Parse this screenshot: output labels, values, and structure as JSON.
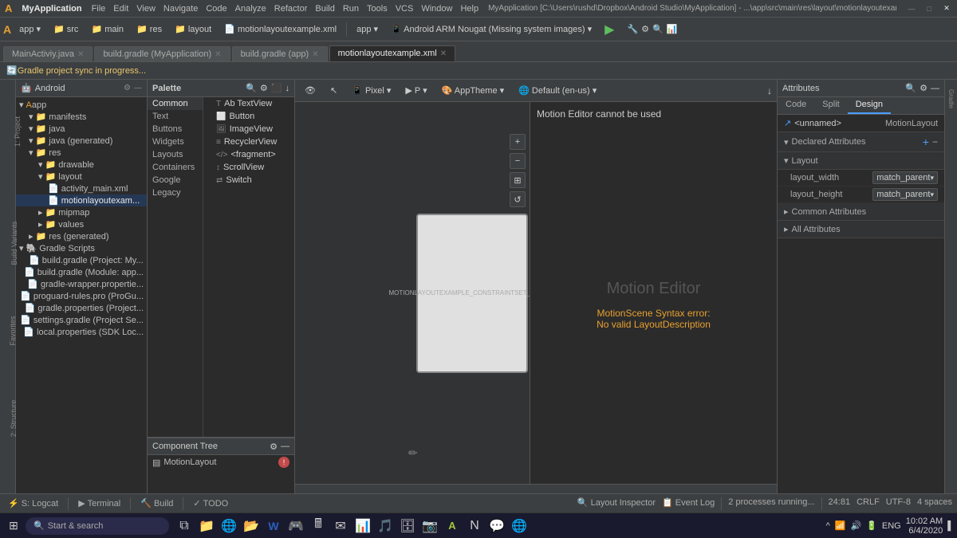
{
  "titlebar": {
    "app_name": "MyApplication",
    "menu": [
      "File",
      "Edit",
      "View",
      "Navigate",
      "Code",
      "Analyze",
      "Refactor",
      "Build",
      "Run",
      "Tools",
      "VCS",
      "Window",
      "Help"
    ],
    "path": "MyApplication [C:\\Users\\rushd\\Dropbox\\Android Studio\\MyApplication] - ...\\app\\src\\main\\res\\layout\\motionlayoutexample.xml [app]",
    "win_controls": [
      "—",
      "□",
      "✕"
    ]
  },
  "toolbar": {
    "project_name": "MyApplication",
    "breadcrumb": [
      "app",
      "src",
      "main",
      "res",
      "layout",
      "motionlayoutexample.xml"
    ]
  },
  "tabs": [
    {
      "label": "MainActiviy.java",
      "active": false
    },
    {
      "label": "build.gradle (MyApplication)",
      "active": false
    },
    {
      "label": "build.gradle (app)",
      "active": false
    },
    {
      "label": "motionlayoutexample.xml",
      "active": true
    }
  ],
  "gradle_notice": "Gradle project sync in progress...",
  "project_panel": {
    "title": "Android",
    "tree": [
      {
        "level": 0,
        "icon": "▾",
        "label": "app",
        "type": "app"
      },
      {
        "level": 1,
        "icon": "▾",
        "label": "manifests",
        "type": "folder"
      },
      {
        "level": 1,
        "icon": "▾",
        "label": "java",
        "type": "folder"
      },
      {
        "level": 1,
        "icon": "▾",
        "label": "java (generated)",
        "type": "folder"
      },
      {
        "level": 1,
        "icon": "▾",
        "label": "res",
        "type": "folder"
      },
      {
        "level": 2,
        "icon": "▾",
        "label": "drawable",
        "type": "folder"
      },
      {
        "level": 2,
        "icon": "▾",
        "label": "layout",
        "type": "folder"
      },
      {
        "level": 3,
        "icon": "📄",
        "label": "activity_main.xml",
        "type": "file"
      },
      {
        "level": 3,
        "icon": "📄",
        "label": "motionlayoutexam...",
        "type": "file",
        "selected": true
      },
      {
        "level": 2,
        "icon": "▸",
        "label": "mipmap",
        "type": "folder"
      },
      {
        "level": 2,
        "icon": "▸",
        "label": "values",
        "type": "folder"
      },
      {
        "level": 1,
        "icon": "▸",
        "label": "res (generated)",
        "type": "folder"
      },
      {
        "level": 0,
        "icon": "▾",
        "label": "Gradle Scripts",
        "type": "gradle"
      },
      {
        "level": 1,
        "icon": "📄",
        "label": "build.gradle (Project: My...",
        "type": "file"
      },
      {
        "level": 1,
        "icon": "📄",
        "label": "build.gradle (Module: app...",
        "type": "file"
      },
      {
        "level": 1,
        "icon": "📄",
        "label": "gradle-wrapper.propertie...",
        "type": "file"
      },
      {
        "level": 1,
        "icon": "📄",
        "label": "proguard-rules.pro (ProGu...",
        "type": "file"
      },
      {
        "level": 1,
        "icon": "📄",
        "label": "gradle.properties (Project...",
        "type": "file"
      },
      {
        "level": 1,
        "icon": "📄",
        "label": "settings.gradle (Project Se...",
        "type": "file"
      },
      {
        "level": 1,
        "icon": "📄",
        "label": "local.properties (SDK Loc...",
        "type": "file"
      }
    ]
  },
  "palette": {
    "title": "Palette",
    "search_placeholder": "Search",
    "categories": [
      {
        "label": "Common",
        "selected": true
      },
      {
        "label": "Text"
      },
      {
        "label": "Buttons"
      },
      {
        "label": "Widgets"
      },
      {
        "label": "Layouts"
      },
      {
        "label": "Containers"
      },
      {
        "label": "Google"
      },
      {
        "label": "Legacy"
      }
    ],
    "widgets": [
      {
        "icon": "T",
        "label": "Ab  TextView"
      },
      {
        "icon": "⬜",
        "label": "Button"
      },
      {
        "icon": "🖼",
        "label": "ImageView"
      },
      {
        "icon": "≡",
        "label": "RecyclerView"
      },
      {
        "icon": "</>",
        "label": "<fragment>"
      },
      {
        "icon": "↕",
        "label": "ScrollView"
      },
      {
        "icon": "⇄",
        "label": "Switch"
      }
    ]
  },
  "component_tree": {
    "title": "Component Tree",
    "items": [
      {
        "label": "MotionLayout",
        "error": true
      }
    ]
  },
  "canvas": {
    "toolbar": {
      "eye_label": "eye",
      "cursor_label": "cursor",
      "device_label": "Pixel",
      "p_label": "P",
      "theme_label": "AppTheme ▾",
      "locale_label": "Default (en-us) ▾"
    },
    "motion_editor_label": "Motion Editor",
    "motion_error_title": "MotionScene Syntax error:",
    "motion_error_detail": "No valid LayoutDescription",
    "motion_cannot": "Motion Editor cannot be used"
  },
  "attributes": {
    "title": "Attributes",
    "tabs": [
      "Code",
      "Split",
      "Design"
    ],
    "active_tab": "Design",
    "named_label": "<unnamed>",
    "named_value": "MotionLayout",
    "sections": {
      "declared": "Declared Attributes",
      "layout": "Layout",
      "common": "Common Attributes",
      "all": "All Attributes"
    },
    "layout_rows": [
      {
        "key": "layout_width",
        "value": "match_parent"
      },
      {
        "key": "layout_height",
        "value": "match_parent"
      }
    ]
  },
  "statusbar": {
    "items": [
      {
        "icon": "⚡",
        "label": "S: Logcat"
      },
      {
        "icon": "▶",
        "label": "Terminal"
      },
      {
        "icon": "🔨",
        "label": "Build"
      },
      {
        "icon": "✓",
        "label": "TODO"
      }
    ],
    "right": {
      "processes": "2 processes running...",
      "line_col": "24:81",
      "encoding": "CRLF",
      "charset": "UTF-8",
      "indent": "4 spaces"
    }
  },
  "taskbar": {
    "start_icon": "⊞",
    "search_placeholder": "Start & search",
    "apps": [
      "⧉",
      "🗂",
      "🌐",
      "📁",
      "W",
      "🎮",
      "🖩",
      "✉",
      "📊",
      "🎵",
      "🗄",
      "📷",
      "🎯",
      "📝"
    ],
    "time": "10:02 AM",
    "date": "6/4/2020",
    "tray_icons": [
      "^",
      "⊞",
      "🔊",
      "📶",
      "🔋"
    ]
  },
  "right_panel_items": [
    {
      "label": "1: Project"
    },
    {
      "label": "Build Variants"
    },
    {
      "label": "Favorites"
    },
    {
      "label": "2: Structure"
    }
  ]
}
